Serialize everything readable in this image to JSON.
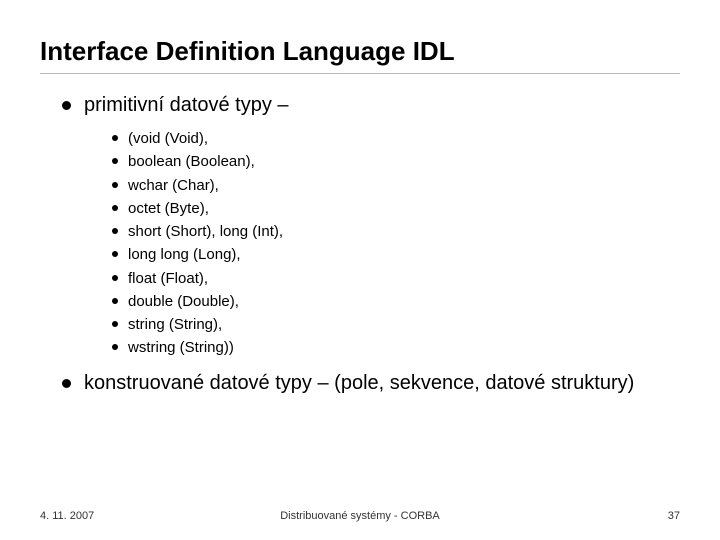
{
  "title": "Interface Definition Language IDL",
  "bullets": [
    {
      "text": "primitivní datové typy –",
      "sub": [
        "(void (Void),",
        "boolean (Boolean),",
        "wchar (Char),",
        "octet (Byte),",
        "short (Short), long (Int),",
        "long long (Long),",
        "float (Float),",
        "double (Double),",
        "string (String),",
        "wstring (String))"
      ]
    },
    {
      "text": "konstruované datové typy – (pole, sekvence, datové struktury)",
      "sub": []
    }
  ],
  "footer": {
    "date": "4. 11. 2007",
    "center": "Distribuované systémy - CORBA",
    "page": "37"
  }
}
